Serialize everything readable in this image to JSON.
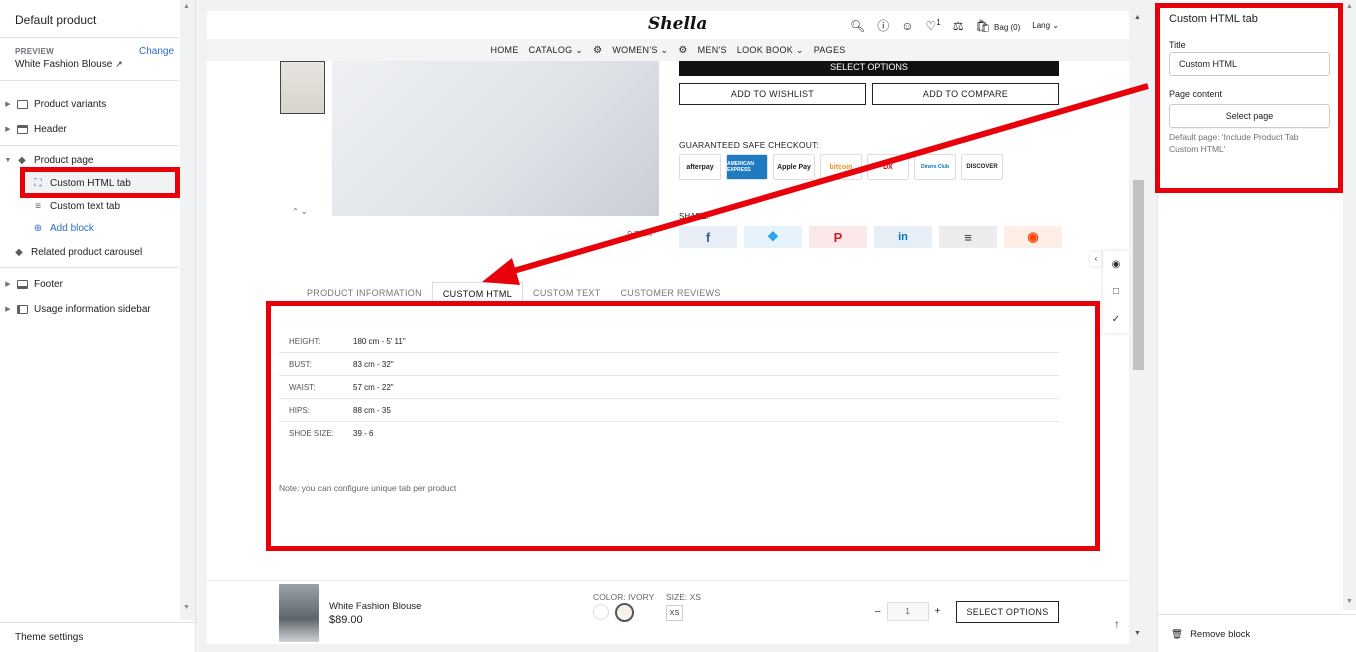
{
  "left_sidebar": {
    "title": "Default product",
    "preview_label": "PREVIEW",
    "change_link": "Change",
    "preview_value": "White Fashion Blouse",
    "items": [
      {
        "label": "Product variants",
        "icon": "variants-icon"
      },
      {
        "label": "Header",
        "icon": "header-icon"
      },
      {
        "label": "Product page",
        "icon": "tag-icon"
      },
      {
        "label": "Custom HTML tab",
        "icon": "custom-html-icon"
      },
      {
        "label": "Custom text tab",
        "icon": "text-icon"
      },
      {
        "label": "Add block",
        "icon": "plus-circle-icon"
      },
      {
        "label": "Related product carousel",
        "icon": "tag-icon"
      },
      {
        "label": "Footer",
        "icon": "footer-icon"
      },
      {
        "label": "Usage information sidebar",
        "icon": "sidebar-icon"
      }
    ],
    "theme_settings": "Theme settings"
  },
  "store": {
    "logo": "Shella",
    "bag": "Bag (0)",
    "lang": "Lang",
    "wishlist_count": "1",
    "menu": [
      "HOME",
      "CATALOG",
      "WOMEN'S",
      "MEN'S",
      "LOOK BOOK",
      "PAGES"
    ],
    "select_options": "SELECT OPTIONS",
    "add_to_wishlist": "ADD TO WISHLIST",
    "add_to_compare": "ADD TO COMPARE",
    "guaranteed": "GUARANTEED SAFE CHECKOUT:",
    "payments": [
      "afterpay",
      "AMERICAN EXPRESS",
      "Apple Pay",
      "bitcoin",
      "DX",
      "Diners Club",
      "DISCOVER"
    ],
    "share_label": "SHARE:",
    "zoom": "Zoom",
    "tabs": [
      "PRODUCT INFORMATION",
      "CUSTOM HTML",
      "CUSTOM TEXT",
      "CUSTOMER REVIEWS"
    ],
    "sizes": [
      {
        "k": "HEIGHT:",
        "v": "180 cm - 5' 11\""
      },
      {
        "k": "BUST:",
        "v": "83 cm - 32\""
      },
      {
        "k": "WAIST:",
        "v": "57 cm - 22\""
      },
      {
        "k": "HIPS:",
        "v": "88 cm - 35"
      },
      {
        "k": "SHOE SIZE:",
        "v": "39 - 6"
      }
    ],
    "note": "Note: you can configure unique tab per product",
    "sticky": {
      "name": "White Fashion Blouse",
      "price": "$89.00",
      "color_label": "COLOR: IVORY",
      "size_label": "SIZE: XS",
      "size_value": "XS",
      "qty": "1",
      "minus": "–",
      "plus": "+",
      "button": "SELECT OPTIONS"
    }
  },
  "right_panel": {
    "title": "Custom HTML tab",
    "title_label": "Title",
    "title_value": "Custom HTML",
    "page_content_label": "Page content",
    "select_page": "Select page",
    "help": "Default page: 'Include Product Tab Custom HTML'",
    "remove_block": "Remove block"
  },
  "colors": {
    "annotation": "#e8000b",
    "link": "#2c6ecb"
  }
}
